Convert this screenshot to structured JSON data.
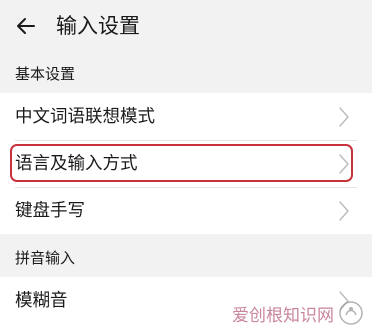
{
  "header": {
    "back_icon": "arrow-left-icon",
    "title": "输入设置"
  },
  "sections": {
    "basic": {
      "title": "基本设置",
      "items": {
        "0": {
          "label": "中文词语联想模式"
        },
        "1": {
          "label": "语言及输入方式",
          "highlighted": true
        },
        "2": {
          "label": "键盘手写"
        }
      }
    },
    "pinyin": {
      "title": "拼音输入",
      "items": {
        "0": {
          "label": "模糊音"
        }
      }
    }
  },
  "colors": {
    "background": "#f2f2f2",
    "card": "#ffffff",
    "highlight": "#c8323c",
    "chevron": "#bdbdbd",
    "watermark": "#c0708a"
  },
  "watermark": {
    "text": "爱创根知识网",
    "icon": "logo-icon"
  }
}
